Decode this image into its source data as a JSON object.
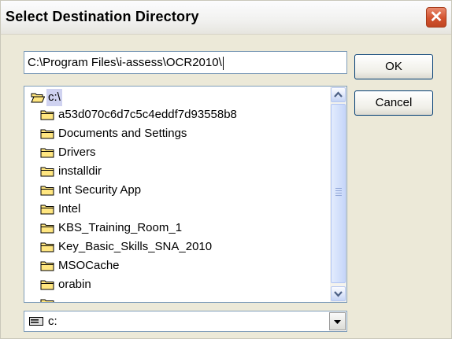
{
  "dialog": {
    "title": "Select Destination Directory",
    "close_glyph": "✕"
  },
  "path_input": {
    "value": "C:\\Program Files\\i-assess\\OCR2010\\"
  },
  "buttons": {
    "ok_label": "OK",
    "cancel_label": "Cancel"
  },
  "directory_list": {
    "root": {
      "label": "c:\\",
      "icon": "open-folder-icon"
    },
    "items": [
      {
        "label": "a53d070c6d7c5c4eddf7d93558b8",
        "icon": "folder-icon"
      },
      {
        "label": "Documents and Settings",
        "icon": "folder-icon"
      },
      {
        "label": "Drivers",
        "icon": "folder-icon"
      },
      {
        "label": "installdir",
        "icon": "folder-icon"
      },
      {
        "label": "Int Security App",
        "icon": "folder-icon"
      },
      {
        "label": "Intel",
        "icon": "folder-icon"
      },
      {
        "label": "KBS_Training_Room_1",
        "icon": "folder-icon"
      },
      {
        "label": "Key_Basic_Skills_SNA_2010",
        "icon": "folder-icon"
      },
      {
        "label": "MSOCache",
        "icon": "folder-icon"
      },
      {
        "label": "orabin",
        "icon": "folder-icon"
      }
    ]
  },
  "drive_select": {
    "value": "c:",
    "icon": "drive-icon"
  },
  "colors": {
    "dialog_bg": "#ece9d8",
    "folder_fill": "#ffe680",
    "folder_stroke": "#000000",
    "selected_bg": "#cfd2f0",
    "close_red": "#d2532f"
  }
}
